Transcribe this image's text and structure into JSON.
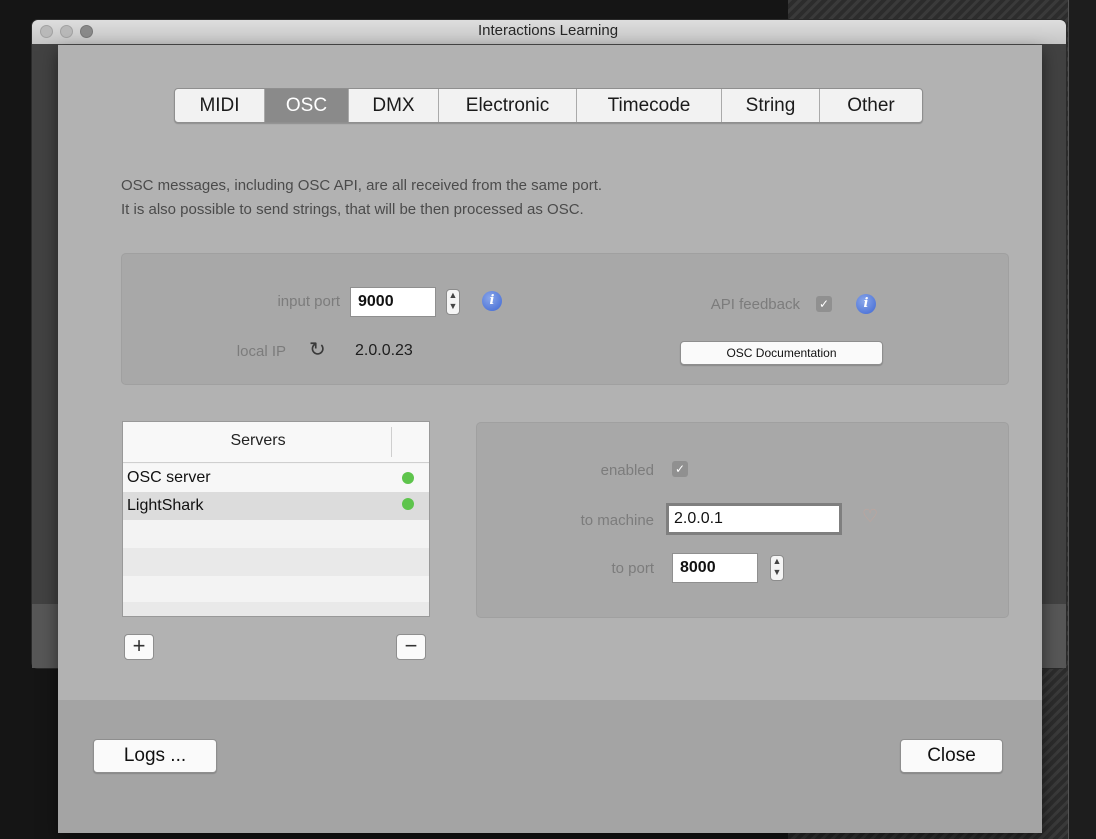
{
  "window": {
    "title": "Interactions Learning"
  },
  "tabs": [
    {
      "label": "MIDI",
      "selected": false
    },
    {
      "label": "OSC",
      "selected": true
    },
    {
      "label": "DMX",
      "selected": false
    },
    {
      "label": "Electronic",
      "selected": false
    },
    {
      "label": "Timecode",
      "selected": false
    },
    {
      "label": "String",
      "selected": false
    },
    {
      "label": "Other",
      "selected": false
    }
  ],
  "description": {
    "line1": "OSC messages, including OSC API, are all received from the same port.",
    "line2": "It is also possible to send strings, that will be then processed as OSC."
  },
  "input": {
    "port_label": "input port",
    "port_value": "9000",
    "local_ip_label": "local IP",
    "local_ip_value": "2.0.0.23",
    "api_feedback_label": "API feedback",
    "api_feedback_checked": true,
    "osc_doc_button": "OSC Documentation"
  },
  "servers": {
    "header": "Servers",
    "rows": [
      {
        "name": "OSC server",
        "status": "active"
      },
      {
        "name": "LightShark",
        "status": "active"
      }
    ],
    "add_label": "+",
    "remove_label": "−"
  },
  "server_detail": {
    "enabled_label": "enabled",
    "enabled_checked": true,
    "machine_label": "to machine",
    "machine_value": "2.0.0.1",
    "port_label": "to port",
    "port_value": "8000"
  },
  "footer": {
    "logs_label": "Logs ...",
    "close_label": "Close"
  },
  "colors": {
    "status_green": "#5ec44c",
    "info_blue": "#3e66d2",
    "selected_tab": "#8a8a8a"
  }
}
